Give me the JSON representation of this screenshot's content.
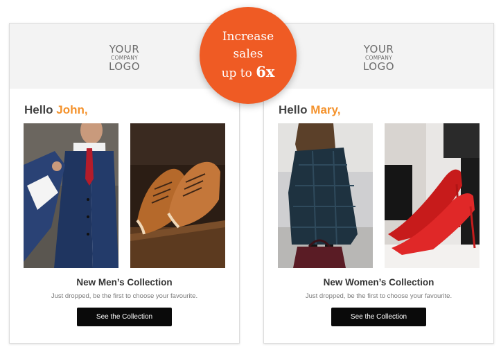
{
  "badge": {
    "line1": "Increase",
    "line2": "sales",
    "line3_prefix": "up to ",
    "multiplier": "6x",
    "color": "#ef5b24"
  },
  "cards": [
    {
      "logo": {
        "line1": "YOUR",
        "line2": "COMPANY",
        "line3": "LOGO"
      },
      "greeting": "Hello ",
      "name": "John,",
      "images": [
        {
          "icon": "man-in-suit-image"
        },
        {
          "icon": "brown-shoes-image"
        }
      ],
      "title": "New Men’s Collection",
      "subtitle": "Just dropped, be the first to choose your favourite.",
      "button_label": "See the Collection"
    },
    {
      "logo": {
        "line1": "YOUR",
        "line2": "COMPANY",
        "line3": "LOGO"
      },
      "greeting": "Hello ",
      "name": "Mary,",
      "images": [
        {
          "icon": "woman-in-coat-image"
        },
        {
          "icon": "red-heels-image"
        }
      ],
      "title": "New Women’s Collection",
      "subtitle": "Just dropped, be the first to choose your favourite.",
      "button_label": "See the Collection"
    }
  ],
  "colors": {
    "accent": "#f4922c",
    "button": "#0a0a0a",
    "header_bg": "#f3f3f3"
  }
}
